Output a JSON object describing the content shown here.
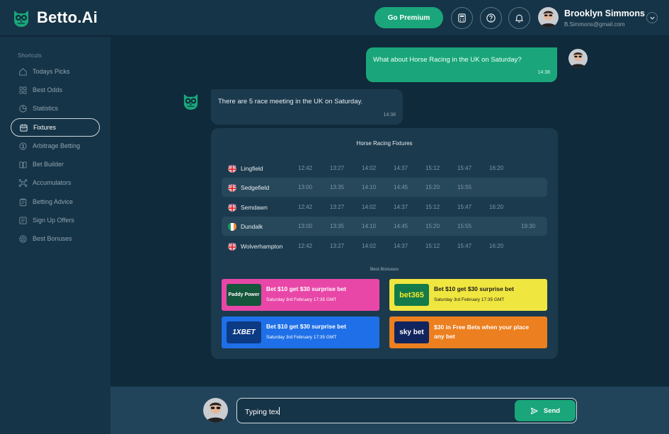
{
  "app": {
    "logo_text": "Betto.Ai"
  },
  "header": {
    "premium_label": "Go Premium",
    "user": {
      "name": "Brooklyn Simmons",
      "email": "B.Simmons@gmail.com"
    }
  },
  "sidebar": {
    "title": "Shortcuts",
    "items": [
      {
        "label": "Todays Picks",
        "icon": "home-icon"
      },
      {
        "label": "Best Odds",
        "icon": "grid-icon"
      },
      {
        "label": "Statistics",
        "icon": "pie-chart-icon"
      },
      {
        "label": "Fixtures",
        "icon": "calendar-icon",
        "active": true
      },
      {
        "label": "Arbitrage Betting",
        "icon": "dollar-icon"
      },
      {
        "label": "Bet Builder",
        "icon": "book-icon"
      },
      {
        "label": "Accumulators",
        "icon": "network-icon"
      },
      {
        "label": "Betting Advice",
        "icon": "clipboard-icon"
      },
      {
        "label": "Sign Up Offers",
        "icon": "list-icon"
      },
      {
        "label": "Best Bonuses",
        "icon": "star-badge-icon"
      }
    ]
  },
  "chat": {
    "user_message": {
      "text": "What about Horse Racing in the UK on Saturday?",
      "time": "14:38"
    },
    "bot_message": {
      "text": "There are 5 race meeting in the UK on Saturday.",
      "time": "14:38"
    }
  },
  "fixtures": {
    "title": "Horse Racing Fixtures",
    "rows": [
      {
        "flag": "uk",
        "venue": "Lingfield",
        "times": [
          "12:42",
          "13:27",
          "14:02",
          "14:37",
          "15:12",
          "15:47",
          "16:20",
          ""
        ]
      },
      {
        "flag": "uk",
        "venue": "Sedgefield",
        "times": [
          "13:00",
          "13:35",
          "14:10",
          "14:45",
          "15:20",
          "15:55",
          "",
          ""
        ]
      },
      {
        "flag": "uk",
        "venue": "Semdawn",
        "times": [
          "12:42",
          "13:27",
          "14:02",
          "14:37",
          "15:12",
          "15:47",
          "16:20",
          ""
        ]
      },
      {
        "flag": "ireland",
        "venue": "Dundalk",
        "times": [
          "13:00",
          "13:35",
          "14:10",
          "14:45",
          "15:20",
          "15:55",
          "",
          "19:30"
        ]
      },
      {
        "flag": "uk",
        "venue": "Wolverhampton",
        "times": [
          "12:42",
          "13:27",
          "14:02",
          "14:37",
          "15:12",
          "15:47",
          "16:20",
          ""
        ]
      }
    ]
  },
  "bonuses": {
    "title": "Best Bonuses",
    "cards": [
      {
        "brand": "Paddy Power",
        "offer": "Bet $10 get $30 surprise bet",
        "date": "Saturday 3rd February 17:35 GMT",
        "bg": "#e847a8",
        "logo_bg": "#14553b",
        "text_color": "#ffffff"
      },
      {
        "brand": "bet365",
        "offer": "Bet $10 get $30 surprise bet",
        "date": "Saturday 3rd February 17:35 GMT",
        "bg": "#f0e640",
        "logo_bg": "#137a4c",
        "text_color": "#1a1a1a"
      },
      {
        "brand": "1XBET",
        "offer": "Bet $10 get $30 surprise bet",
        "date": "Saturday 3rd February 17:35 GMT",
        "bg": "#1f70e8",
        "logo_bg": "#0c3a83",
        "text_color": "#ffffff"
      },
      {
        "brand": "sky bet",
        "offer": "$30 in Free Bets when your place any bet",
        "date": "",
        "bg": "#ec7f1f",
        "logo_bg": "#10245e",
        "text_color": "#ffffff"
      }
    ]
  },
  "composer": {
    "value": "Typing tex",
    "send_label": "Send"
  },
  "colors": {
    "accent": "#1aa67a",
    "bg": "#0f2a3a",
    "panel": "#163447",
    "card": "#1b3a4d"
  }
}
